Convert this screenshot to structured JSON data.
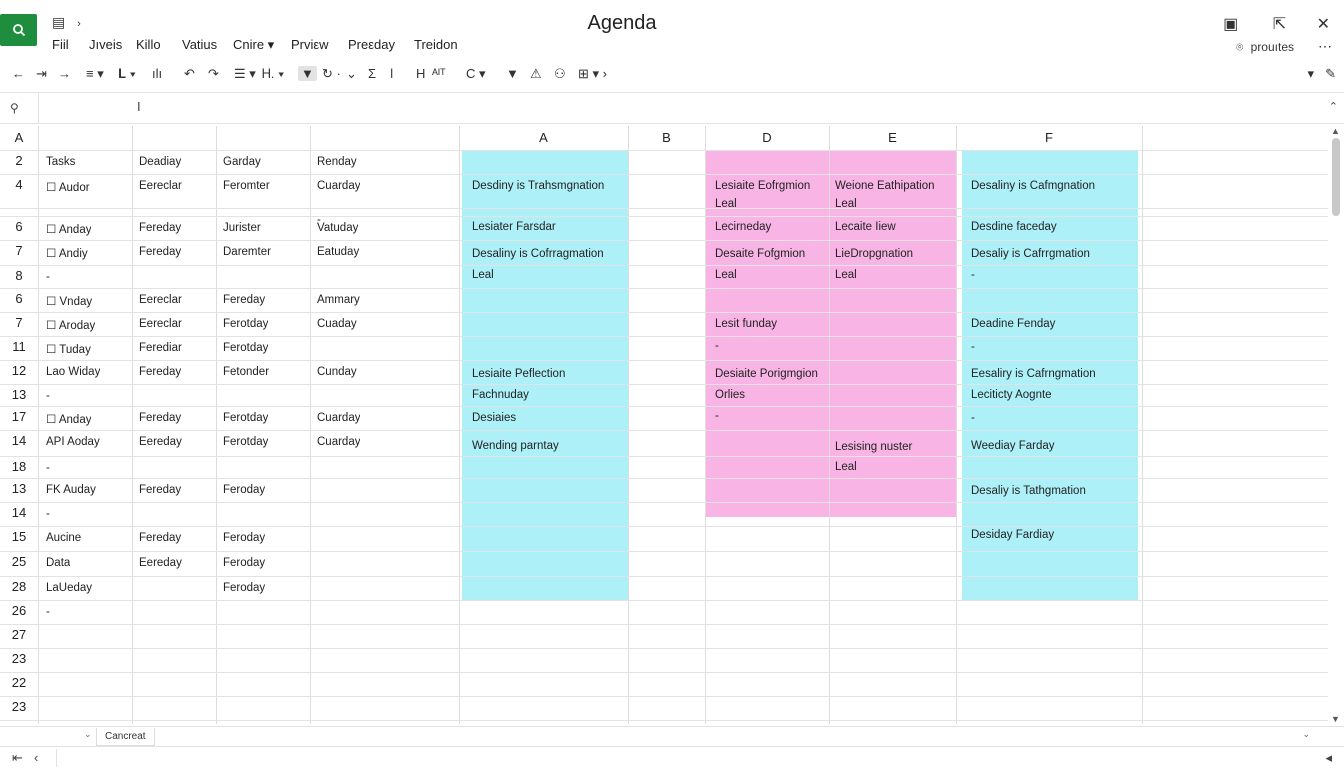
{
  "app": {
    "title": "Agenda",
    "menu": [
      "Fiil",
      "Jıveis",
      "Killo",
      "Vatius",
      "Cnire ▾",
      "Prviεw",
      "Preεday",
      "Treidon"
    ],
    "profile_label": "prouıtes",
    "sheet_tab": "Cancreat"
  },
  "accent_colors": {
    "brand": "#1e8e3e",
    "cyan_fill": "#aef0f8",
    "pink_fill": "#f8b4e4"
  },
  "grid": {
    "header_a": "A",
    "col_letters": [
      "A",
      "B",
      "D",
      "E",
      "F"
    ],
    "row_numbers": [
      "2",
      "4",
      "",
      "6",
      "7",
      "8",
      "6",
      "7",
      "11",
      "12",
      "13",
      "17",
      "14",
      "18",
      "13",
      "14",
      "15",
      "25",
      "28",
      "26",
      "27",
      "23",
      "22",
      "23"
    ],
    "left_cells": [
      [
        "Tasks",
        "Deadiay",
        "Garday",
        "Renday"
      ],
      [
        "☐ Audor",
        "Eereclar",
        "Feromter",
        "Cuarday"
      ],
      [
        "",
        "",
        "",
        "-"
      ],
      [
        "☐ Anday",
        "Fereday",
        "Jurister",
        "Vatuday"
      ],
      [
        "☐ Andiy",
        "Fereday",
        "Daremter",
        "Eatuday"
      ],
      [
        "-",
        "",
        "",
        ""
      ],
      [
        "☐ Vnday",
        "Eereclar",
        "Fereday",
        "Ammary"
      ],
      [
        "☐ Aroday",
        "Eereclar",
        "Ferotday",
        "Cuaday"
      ],
      [
        "☐ Tuday",
        "Ferediar",
        "Ferotday",
        ""
      ],
      [
        "Lao Widay",
        "Fereday",
        "Fetonder",
        "Cunday"
      ],
      [
        "-",
        "",
        "",
        ""
      ],
      [
        "☐ Anday",
        "Fereday",
        "Ferotday",
        "Cuarday"
      ],
      [
        "API Aoday",
        "Eereday",
        "Ferotday",
        "Cuarday"
      ],
      [
        "-",
        "",
        "",
        ""
      ],
      [
        "FK Auday",
        "Fereday",
        "Feroday",
        ""
      ],
      [
        "-",
        "",
        "",
        ""
      ],
      [
        "Aucine",
        "Fereday",
        "Feroday",
        ""
      ],
      [
        "Data",
        "Eereday",
        "Feroday",
        ""
      ],
      [
        "LaUeday",
        "",
        "Feroday",
        ""
      ],
      [
        "-",
        "",
        "",
        ""
      ],
      [
        "",
        "",
        "",
        ""
      ],
      [
        "",
        "",
        "",
        ""
      ],
      [
        "",
        "",
        "",
        ""
      ],
      [
        "",
        "",
        "",
        ""
      ]
    ],
    "col_a_cells": [
      "Desdiny is Trahsmgnation",
      "Lesiater Farsdar",
      "Desaliny is Cofrragmation",
      "Leal",
      "Lesiaite Peflection",
      "Fachnuday",
      "Desiaies",
      "Wending parntay"
    ],
    "col_d_cells": [
      "Lesiaite Eofrgmion",
      "Leal",
      "Lecirneday",
      "Desaite Fofgmion",
      "Leal",
      "Lesit funday",
      "-",
      "Desiaite Porigmgion",
      "Orlies",
      "-"
    ],
    "col_e_cells": [
      "Weione Eathipation",
      "Leal",
      "Lecaite Iiew",
      "LieDropgnation",
      "Leal",
      "Lesising nuster",
      "Leal"
    ],
    "col_f_cells": [
      "Desaliny is Cafmgnation",
      "Desdine faceday",
      "Desaliy is Cafrrgmation",
      "-",
      "Deadine Fenday",
      "-",
      "Eesaliry is Cafrngmation",
      "Leciticty Aognte",
      "-",
      "Weediay Farday",
      "Desaliy is Tathgmation",
      "Desiday Fardiay"
    ]
  }
}
